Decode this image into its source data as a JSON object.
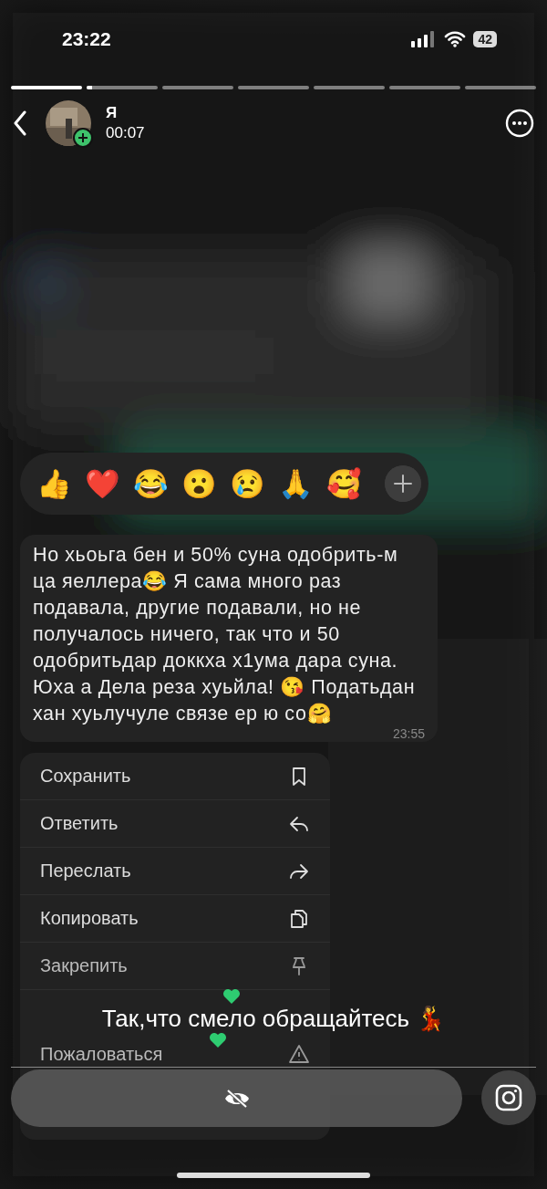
{
  "status_bar": {
    "time": "23:22",
    "battery": "42"
  },
  "story_progress": [
    {
      "kind": "viewed",
      "level": 1
    },
    {
      "kind": "current",
      "level": 0.08
    },
    {
      "kind": "upcoming"
    },
    {
      "kind": "upcoming"
    },
    {
      "kind": "upcoming"
    },
    {
      "kind": "upcoming"
    },
    {
      "kind": "upcoming"
    }
  ],
  "header": {
    "name": "Я",
    "time": "00:07"
  },
  "reactions": [
    "👍",
    "❤️",
    "😂",
    "😮",
    "😢",
    "🙏",
    "🥰"
  ],
  "message": {
    "text": "Но хьоьга бен и 50% суна одобрить-м ца яеллера😂 Я сама много раз подавала, другие подавали, но не получалось ничего, так что и 50 одобритьдар доккха х1ума дара суна. Юха а Дела реза хуьйла! 😘 Податьдан хан хуьлучуле связе ер ю со🤗",
    "time": "23:55"
  },
  "menu": [
    {
      "label": "Сохранить"
    },
    {
      "label": "Ответить"
    },
    {
      "label": "Переслать"
    },
    {
      "label": "Копировать"
    },
    {
      "label": "Закрепить"
    },
    {
      "label": "Пожаловаться"
    }
  ],
  "caption": "Так,что смело обращайтесь 💃"
}
